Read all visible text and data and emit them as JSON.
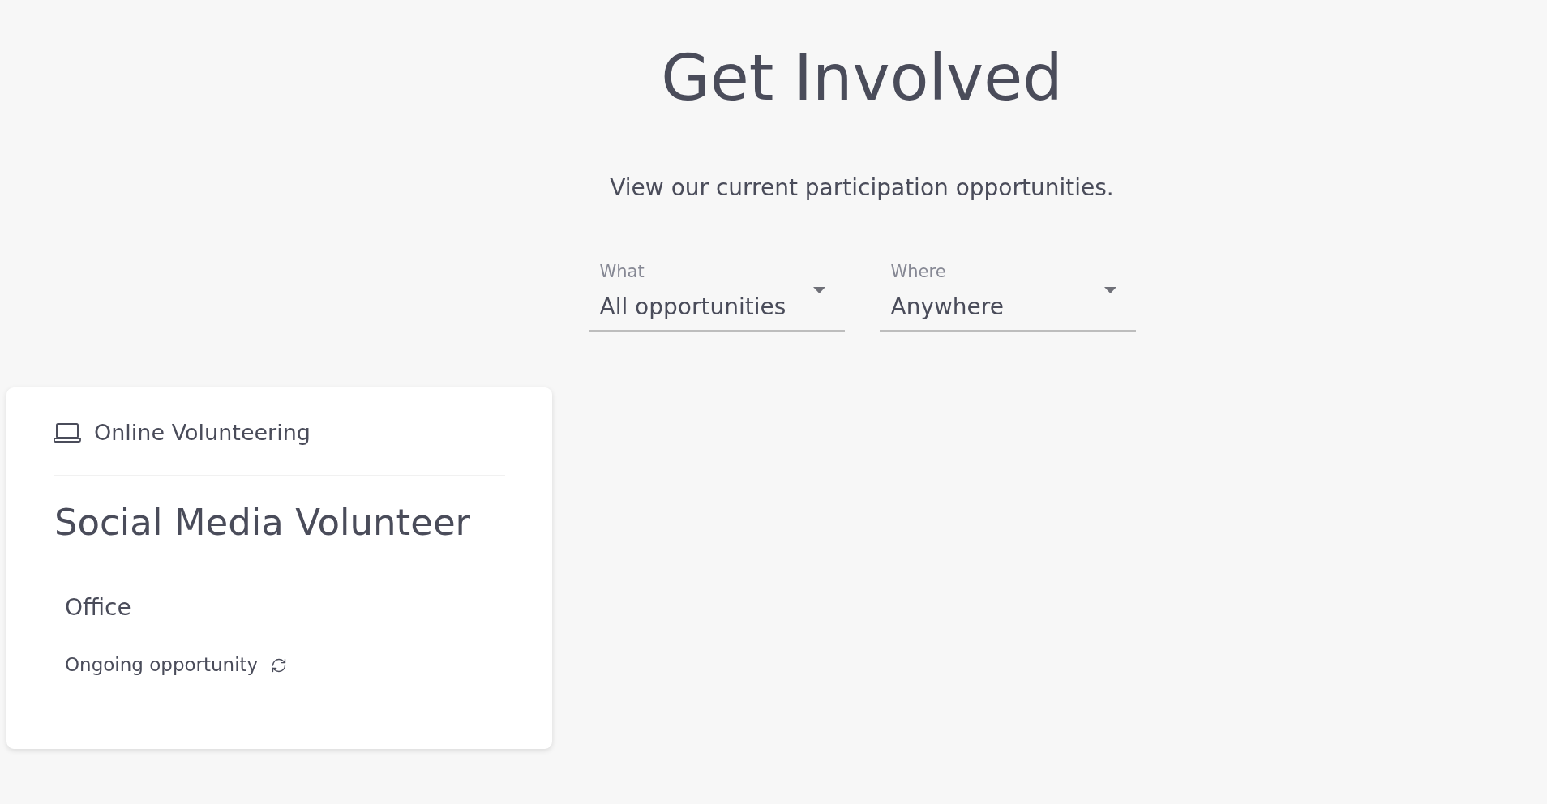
{
  "header": {
    "title": "Get Involved",
    "subtitle": "View our current participation opportunities."
  },
  "filters": [
    {
      "label": "What",
      "value": "All opportunities"
    },
    {
      "label": "Where",
      "value": "Anywhere"
    }
  ],
  "opportunities": [
    {
      "category": "Online Volunteering",
      "title": "Social Media Volunteer",
      "location": "Office",
      "schedule": "Ongoing opportunity"
    }
  ]
}
